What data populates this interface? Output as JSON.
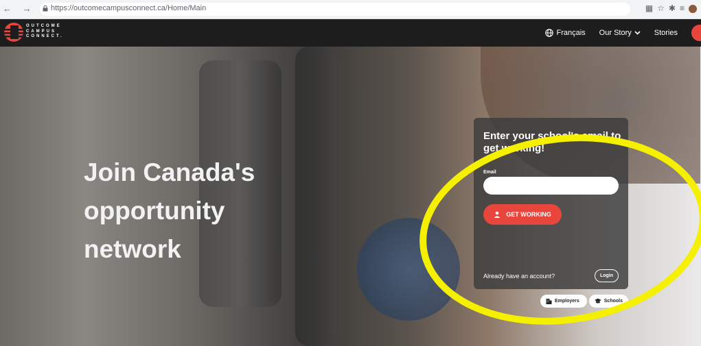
{
  "browser": {
    "url": "https://outcomecampusconnect.ca/Home/Main",
    "nav_glyphs": "← → C"
  },
  "navbar": {
    "logo_lines": [
      "OUTCOME",
      "CAMPUS",
      "CONNECT."
    ],
    "language_label": "Français",
    "story_label": "Our Story",
    "stories_label": "Stories"
  },
  "hero": {
    "headline_lines": [
      "Join Canada's",
      "opportunity",
      "network"
    ]
  },
  "signup": {
    "title": "Enter your school's email to get working!",
    "email_label": "Email",
    "email_value": "",
    "email_placeholder": "",
    "cta_label": "GET WORKING",
    "account_prompt": "Already have an account?",
    "login_label": "Login"
  },
  "audience": {
    "employers_label": "Employers",
    "schools_label": "Schools"
  },
  "colors": {
    "accent": "#e8453c",
    "navbar_bg": "#1d1d1d",
    "highlight_ellipse": "#f5f000"
  }
}
